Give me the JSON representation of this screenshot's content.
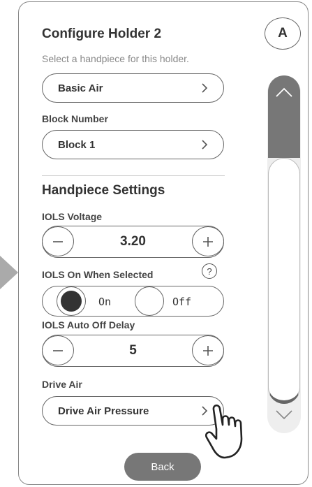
{
  "avatar": {
    "label": "A"
  },
  "header": {
    "title": "Configure Holder 2",
    "subtitle": "Select a handpiece for this holder."
  },
  "handpiece_select": {
    "value": "Basic Air"
  },
  "block_number": {
    "label": "Block Number",
    "value": "Block 1"
  },
  "handpiece_settings": {
    "title": "Handpiece Settings",
    "iols_voltage": {
      "label": "IOLS Voltage",
      "value": "3.20"
    },
    "iols_on_when_selected": {
      "label": "IOLS On When Selected",
      "help_icon": "?",
      "options": [
        "On",
        "Off"
      ],
      "selected": "On"
    },
    "iols_auto_off_delay": {
      "label": "IOLS Auto Off Delay",
      "value": "5"
    },
    "drive_air": {
      "label": "Drive Air",
      "value": "Drive Air Pressure"
    }
  },
  "footer": {
    "back_label": "Back"
  },
  "icons": {
    "chevron": "chevron-right-icon",
    "minus": "minus-icon",
    "plus": "plus-icon",
    "scroll_up": "chevron-up-icon",
    "scroll_down": "chevron-down-icon",
    "cursor": "hand-pointer-icon"
  },
  "colors": {
    "border": "#666666",
    "scroll_active": "#777777",
    "back_button": "#777777",
    "track": "#eeeeee"
  }
}
